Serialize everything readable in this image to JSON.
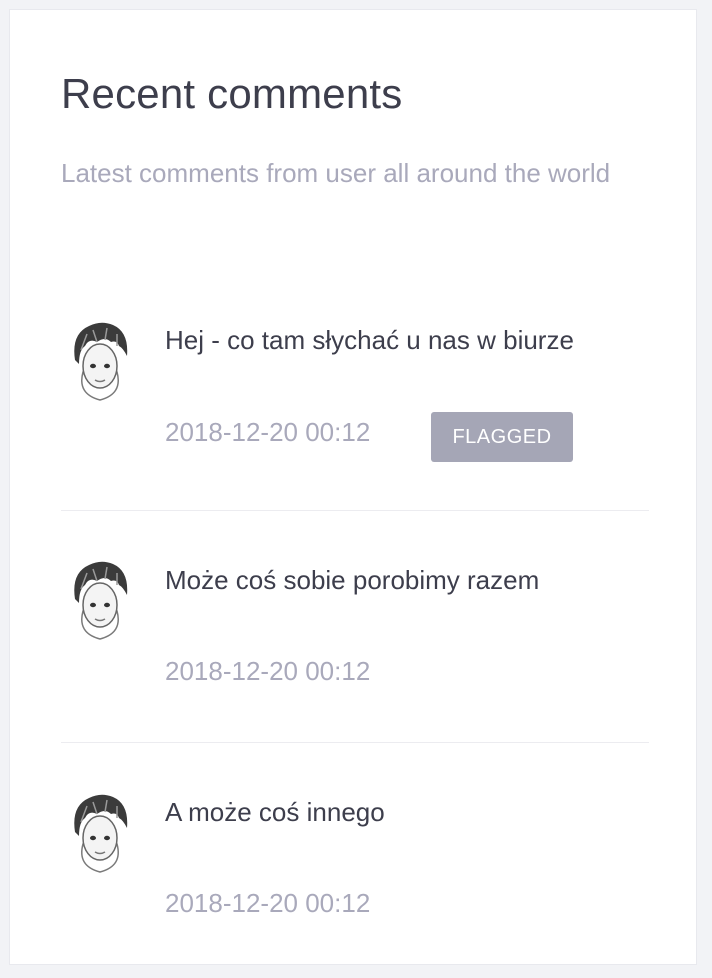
{
  "card": {
    "title": "Recent comments",
    "subtitle": "Latest comments from user all around the world"
  },
  "comments": [
    {
      "text": "Hej - co tam słychać u nas w biurze",
      "date": "2018-12-20 00:12",
      "badge": "FLAGGED",
      "avatar_icon": "user-avatar-icon"
    },
    {
      "text": "Może coś sobie porobimy razem",
      "date": "2018-12-20 00:12",
      "avatar_icon": "user-avatar-icon"
    },
    {
      "text": "A może coś innego",
      "date": "2018-12-20 00:12",
      "avatar_icon": "user-avatar-icon"
    }
  ],
  "colors": {
    "page_background": "#f2f3f6",
    "card_background": "#ffffff",
    "title_text": "#3d3e4c",
    "muted_text": "#a9a9bb",
    "badge_background": "#a5a6b6",
    "badge_text": "#ffffff"
  }
}
